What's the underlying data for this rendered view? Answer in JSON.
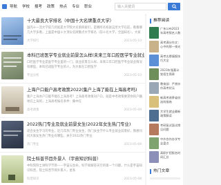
{
  "nav": {
    "items": [
      "导航",
      "学校",
      "报考",
      "政策",
      "热点",
      "专业",
      "职业"
    ]
  },
  "search": {
    "placeholder": "输入关键词"
  },
  "articles": [
    {
      "title": "十大最良大学排名（中国十大名牌重点大学）",
      "desc": "国内十一流大学前几何就是大学院大名第四家们，是哪所名校就这所大学在前，看看哪几大学多看，上面是中国十大顶尖名牌重点大学排名（前十名大学，全国知名），大家",
      "meta": "大学排行",
      "date": "2023-05-10",
      "thumb_color": "#7ea6d8"
    },
    {
      "title": "本科已班医学专业就业前景怎么样(未来三年口腔医学专业就业情况)",
      "desc": "口腔医学专业是医学专业里的一门，就业前景怎么样，未来三年口腔医学专业就业情况有哪些，本科已班医学专业的人，为大家在口腔医学",
      "meta": "专业分析",
      "date": "2023-05-10",
      "thumb_color": "#8a9a7c"
    },
    {
      "title": "上海户口能户高考政策2022(集户上海了能在上海高考吗)",
      "desc": "集户上海办户口能不能在上海高考？上海高考政策对户口，就是中考政策要求你的户籍地在上海的，上海高考报名条件：集中在",
      "meta": "高考政策",
      "date": "2023-05-09",
      "thumb_color": "#c9c3b4"
    },
    {
      "title": "2022热门专业及就业前景女生(2022年女生热门专业)",
      "desc": "适合女生学习的专业，近几年热门专业女生，热门女生学什么专业就业前景好，我想问问大家女生热门专业有哪些，关于2022热门专业",
      "meta": "热门专业",
      "date": "2023-05-09",
      "thumb_color": "#3f4a5c"
    },
    {
      "title": "院士科普节目外景人（宇宙知识科普）",
      "desc": "中科院院士讲科学节目——宇宙与生命，科学家解答天空的第一个问题，什么是宇宙知识科普，院士科普节目外景人，星系",
      "meta": "科普知识",
      "date": "2023-05-08",
      "thumb_color": "#cdd7a8"
    }
  ],
  "side": {
    "title": "推荐阅读",
    "items": [
      {
        "text": "广东公布2023年高考报名人数",
        "color": "#2f7d4e"
      },
      {
        "text": "高考满分作文：心中的那一束光",
        "color": "#c9b18a"
      },
      {
        "text": "高考志愿填报技巧大全",
        "color": "#5b8fd6"
      },
      {
        "text": "2023年强基计划招生简章",
        "color": "#6e8e5a"
      },
      {
        "text": "教育部：严禁炒作高考状元",
        "color": "#9aa7b5"
      },
      {
        "text": "新高考改革省份选科指南",
        "color": "#d8c07a"
      },
      {
        "text": "大学生就业最新政策解读",
        "color": "#4d6e91"
      },
      {
        "text": "考研复试面试常见问题",
        "color": "#b57a5e"
      },
      {
        "text": "中外合作办学专业盘点",
        "color": "#7fa36e"
      },
      {
        "text": "高职扩招报名时间汇总",
        "color": "#8c8fb8"
      }
    ],
    "title2": "热门文章"
  }
}
